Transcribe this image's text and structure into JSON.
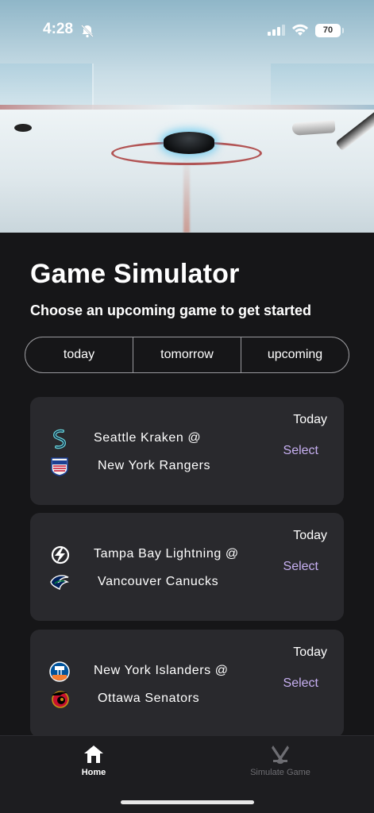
{
  "status_bar": {
    "time": "4:28",
    "battery": "70"
  },
  "page": {
    "title": "Game Simulator",
    "subtitle": "Choose an upcoming game to get started"
  },
  "tabs": [
    {
      "label": "today"
    },
    {
      "label": "tomorrow"
    },
    {
      "label": "upcoming"
    }
  ],
  "games": [
    {
      "date": "Today",
      "away": "Seattle Kraken @",
      "home": "New York Rangers",
      "action": "Select",
      "away_icon": "kraken-logo-icon",
      "home_icon": "rangers-logo-icon"
    },
    {
      "date": "Today",
      "away": "Tampa Bay Lightning @",
      "home": "Vancouver Canucks",
      "action": "Select",
      "away_icon": "lightning-logo-icon",
      "home_icon": "canucks-logo-icon"
    },
    {
      "date": "Today",
      "away": "New York Islanders @",
      "home": "Ottawa Senators",
      "action": "Select",
      "away_icon": "islanders-logo-icon",
      "home_icon": "senators-logo-icon"
    }
  ],
  "nav": [
    {
      "label": "Home",
      "icon": "home-icon",
      "active": true
    },
    {
      "label": "Simulate Game",
      "icon": "hockey-sticks-icon",
      "active": false
    }
  ],
  "colors": {
    "accent": "#c7b0f2",
    "card": "#29292d",
    "background": "#161618"
  }
}
